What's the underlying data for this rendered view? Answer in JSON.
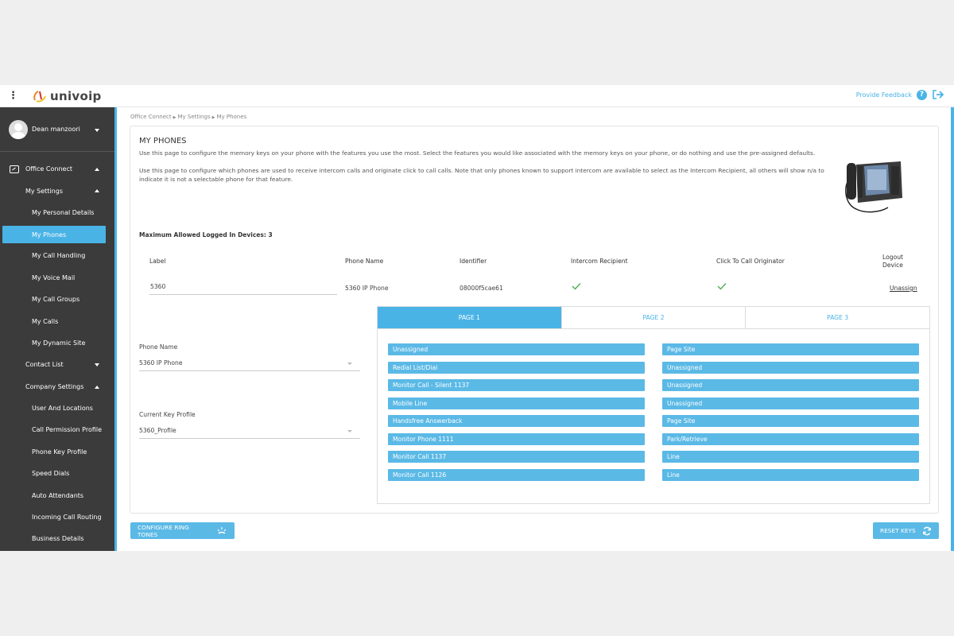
{
  "header": {
    "logo_text": "univoip",
    "feedback_label": "Provide Feedback",
    "help_glyph": "?",
    "icons": [
      "kebab-menu-icon",
      "help-icon",
      "logout-icon"
    ]
  },
  "sidebar": {
    "user_name": "Dean manzoori",
    "items": [
      {
        "label": "Office Connect"
      },
      {
        "label": "My Settings"
      },
      {
        "label": "My Personal Details"
      },
      {
        "label": "My Phones"
      },
      {
        "label": "My Call Handling"
      },
      {
        "label": "My Voice Mail"
      },
      {
        "label": "My Call Groups"
      },
      {
        "label": "My Calls"
      },
      {
        "label": "My Dynamic Site"
      },
      {
        "label": "Contact List"
      },
      {
        "label": "Company Settings"
      },
      {
        "label": "User And Locations"
      },
      {
        "label": "Call Permission Profile"
      },
      {
        "label": "Phone Key Profile"
      },
      {
        "label": "Speed Dials"
      },
      {
        "label": "Auto Attendants"
      },
      {
        "label": "Incoming Call Routing"
      },
      {
        "label": "Business Details"
      }
    ]
  },
  "breadcrumb": [
    "Office Connect",
    "My Settings",
    "My Phones"
  ],
  "page": {
    "title": "MY PHONES",
    "desc1": "Use this page to configure the memory keys on your phone with the features you use the most. Select the features you would like associated with the memory keys on your phone, or do nothing and use the pre-assigned defaults.",
    "desc2": "Use this page to configure which phones are used to receive intercom calls and originate click to call calls. Note that only phones known to support intercom are available to select as the Intercom Recipient, all others will show n/a to indicate it is not a selectable phone for that feature.",
    "max_logged_label": "Maximum Allowed Logged In Devices: 3"
  },
  "table": {
    "headers": {
      "label": "Label",
      "phone_name": "Phone Name",
      "identifier": "Identifier",
      "intercom": "Intercom Recipient",
      "click_to_call": "Click To Call Originator",
      "logout_1": "Logout",
      "logout_2": "Device"
    },
    "row": {
      "label": "5360",
      "phone_name": "5360 IP Phone",
      "identifier": "08000f5cae61",
      "intercom_recipient": true,
      "click_to_call_originator": true,
      "action": "Unassign"
    }
  },
  "form": {
    "phone_name_label": "Phone Name",
    "phone_name_value": "5360 IP Phone",
    "key_profile_label": "Current Key Profile",
    "key_profile_value": "5360_Profile"
  },
  "tabs": [
    "PAGE 1",
    "PAGE 2",
    "PAGE 3"
  ],
  "keys": {
    "left": [
      "Unassigned",
      "Redial List/Dial",
      "Monitor Call - Silent 1137",
      "Mobile Line",
      "Handsfree Answerback",
      "Monitor Phone 1111",
      "Monitor Call 1137",
      "Monitor Call 1126"
    ],
    "right": [
      "Page Site",
      "Unassigned",
      "Unassigned",
      "Unassigned",
      "Page Site",
      "Park/Retrieve",
      "Line",
      "Line"
    ]
  },
  "buttons": {
    "configure_ring_tones": "CONFIGURE RING TONES",
    "reset_keys": "RESET KEYS"
  },
  "colors": {
    "accent": "#4ab3e6",
    "sidebar_bg": "#3b3b3b"
  }
}
